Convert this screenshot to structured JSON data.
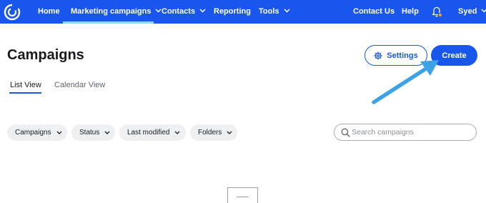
{
  "nav": {
    "items": [
      {
        "label": "Home"
      },
      {
        "label": "Marketing campaigns"
      },
      {
        "label": "Contacts"
      },
      {
        "label": "Reporting"
      },
      {
        "label": "Tools"
      }
    ],
    "right": {
      "contact_us": "Contact Us",
      "help": "Help",
      "user": "Syed"
    }
  },
  "header": {
    "title": "Campaigns",
    "settings_label": "Settings",
    "create_label": "Create"
  },
  "tabs": {
    "list_view": "List View",
    "calendar_view": "Calendar View"
  },
  "filters": {
    "campaigns": "Campaigns",
    "status": "Status",
    "last_modified": "Last modified",
    "folders": "Folders"
  },
  "search": {
    "placeholder": "Search campaigns",
    "value": ""
  },
  "colors": {
    "brand": "#1856ed",
    "nav_active_underline": "#8fd6ff",
    "notification_dot": "#f59b2d",
    "annotation_arrow": "#3da3e6"
  },
  "icons": {
    "logo": "constant-contact-logo-icon",
    "bell": "bell-icon",
    "settings": "gear-icon",
    "search": "search-icon",
    "dropdown": "chevron-down-icon"
  }
}
